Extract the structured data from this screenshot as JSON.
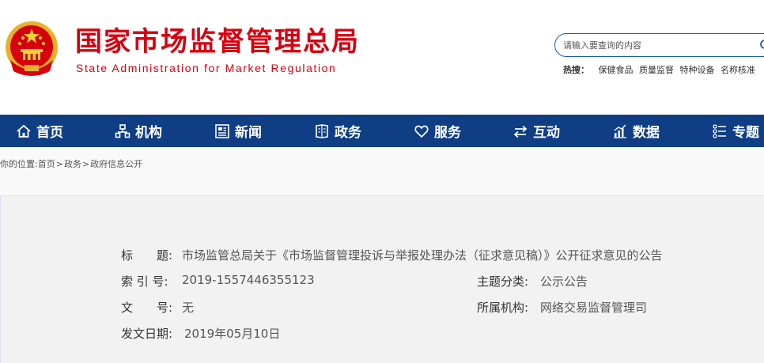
{
  "header": {
    "title_cn": "国家市场监督管理总局",
    "title_en": "State Administration for Market Regulation",
    "emblem_icon": "national-emblem-icon",
    "search": {
      "placeholder": "请输入要查询的内容",
      "icon": "search-icon"
    },
    "hot": {
      "label": "热搜：",
      "links": [
        "保健食品",
        "质量监督",
        "特种设备",
        "名称核准"
      ]
    }
  },
  "nav": {
    "items": [
      {
        "label": "首页",
        "icon": "home-icon"
      },
      {
        "label": "机构",
        "icon": "org-chart-icon"
      },
      {
        "label": "新闻",
        "icon": "newspaper-icon"
      },
      {
        "label": "政务",
        "icon": "document-icon"
      },
      {
        "label": "服务",
        "icon": "heart-icon"
      },
      {
        "label": "互动",
        "icon": "exchange-icon"
      },
      {
        "label": "数据",
        "icon": "bar-chart-icon"
      },
      {
        "label": "专题",
        "icon": "list-icon"
      }
    ]
  },
  "breadcrumb": {
    "prefix": "你的位置:",
    "items": [
      "首页",
      "政务",
      "政府信息公开"
    ],
    "separator": ">"
  },
  "info": {
    "title_label": "标　　题:",
    "title_value": "市场监管总局关于《市场监督管理投诉与举报处理办法（征求意见稿）》公开征求意见的公告",
    "index_label": "索 引 号:",
    "index_value": "2019-1557446355123",
    "topic_label": "主题分类:",
    "topic_value": "公示公告",
    "doc_label": "文　　号:",
    "doc_value": "无",
    "org_label": "所属机构:",
    "org_value": "网络交易监督管理司",
    "date_label": "发文日期:",
    "date_value": "2019年05月10日"
  },
  "colors": {
    "brand_red": "#d7000f",
    "nav_blue": "#0f3e84",
    "search_border": "#1b5ea8"
  }
}
